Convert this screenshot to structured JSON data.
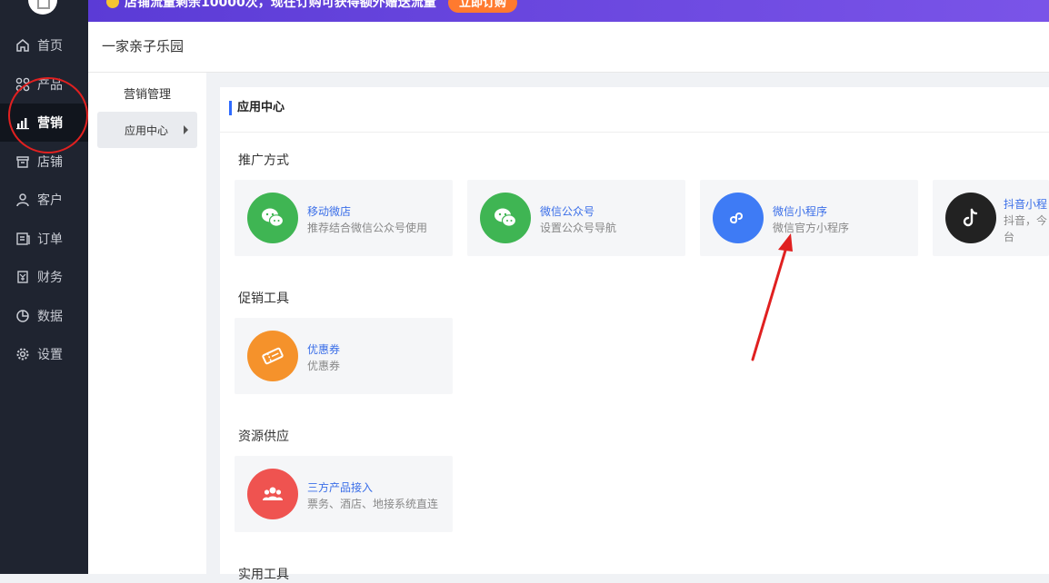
{
  "banner": {
    "text": "店铺流量剩余10000次，现在订购可获得额外赠送流量",
    "button_label": "立即订购"
  },
  "sidebar": {
    "items": [
      {
        "label": "首页",
        "icon": "home-icon"
      },
      {
        "label": "产品",
        "icon": "grid-icon"
      },
      {
        "label": "营销",
        "icon": "bar-chart-icon"
      },
      {
        "label": "店铺",
        "icon": "store-icon"
      },
      {
        "label": "客户",
        "icon": "user-icon"
      },
      {
        "label": "订单",
        "icon": "order-icon"
      },
      {
        "label": "财务",
        "icon": "finance-icon"
      },
      {
        "label": "数据",
        "icon": "pie-chart-icon"
      },
      {
        "label": "设置",
        "icon": "gear-icon"
      }
    ],
    "active_index": 2
  },
  "header": {
    "store_name": "一家亲子乐园"
  },
  "subnav": {
    "title": "营销管理",
    "items": [
      {
        "label": "应用中心"
      }
    ]
  },
  "content": {
    "title": "应用中心",
    "sections": [
      {
        "title": "推广方式",
        "cards": [
          {
            "title": "移动微店",
            "desc": "推荐结合微信公众号使用",
            "icon": "wechat-icon",
            "color": "#3fb553"
          },
          {
            "title": "微信公众号",
            "desc": "设置公众号导航",
            "icon": "wechat-icon",
            "color": "#3fb553"
          },
          {
            "title": "微信小程序",
            "desc": "微信官方小程序",
            "icon": "mini-program-icon",
            "color": "#3e7bf5"
          },
          {
            "title": "抖音小程",
            "desc": "抖音，今",
            "desc2": "台",
            "icon": "tiktok-icon",
            "color": "#222222"
          }
        ]
      },
      {
        "title": "促销工具",
        "cards": [
          {
            "title": "优惠券",
            "desc": "优惠券",
            "icon": "coupon-icon",
            "color": "#f5922b"
          }
        ]
      },
      {
        "title": "资源供应",
        "cards": [
          {
            "title": "三方产品接入",
            "desc": "票务、酒店、地接系统直连",
            "icon": "group-icon",
            "color": "#ef5350"
          }
        ]
      },
      {
        "title": "实用工具",
        "cards": []
      }
    ]
  }
}
